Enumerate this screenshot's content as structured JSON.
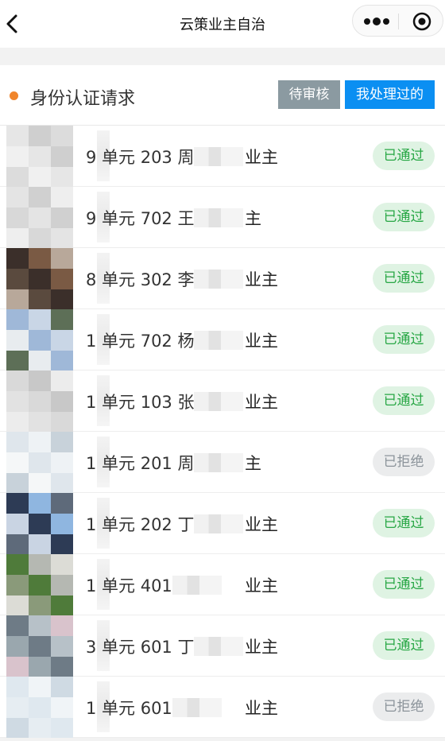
{
  "navbar": {
    "title": "云策业主自治",
    "back_icon": "chevron-left-icon",
    "more_icon": "more-dots-icon",
    "close_icon": "target-circle-icon"
  },
  "header": {
    "title": "身份认证请求",
    "filter_pending": "待审核",
    "filter_processed": "我处理过的",
    "dot_color": "#f0852b",
    "active_color": "#0b8ff2",
    "inactive_color": "#8b9aa1"
  },
  "records": [
    {
      "name": "9 单元 203 周",
      "suffix": "业主",
      "status": "已通过"
    },
    {
      "name": "9 单元 702 王",
      "suffix": "主",
      "status": "已通过"
    },
    {
      "name": "8 单元 302 李",
      "suffix": "业主",
      "status": "已通过"
    },
    {
      "name": "1 单元 702 杨",
      "suffix": "业主",
      "status": "已通过"
    },
    {
      "name": "1 单元 103 张",
      "suffix": "业主",
      "status": "已通过"
    },
    {
      "name": "1 单元 201 周",
      "suffix": "主",
      "status": "已拒绝"
    },
    {
      "name": "1 单元 202 丁",
      "suffix": "业主",
      "status": "已通过"
    },
    {
      "name": "1 单元 401",
      "suffix": "业主",
      "status": "已通过"
    },
    {
      "name": "3 单元 601 丁",
      "suffix": "业主",
      "status": "已通过"
    },
    {
      "name": "1 单元 601",
      "suffix": "业主",
      "status": "已拒绝"
    }
  ],
  "status_colors": {
    "已通过": {
      "bg": "#dff3e3",
      "fg": "#28a745"
    },
    "已拒绝": {
      "bg": "#ebeced",
      "fg": "#8b939a"
    }
  }
}
